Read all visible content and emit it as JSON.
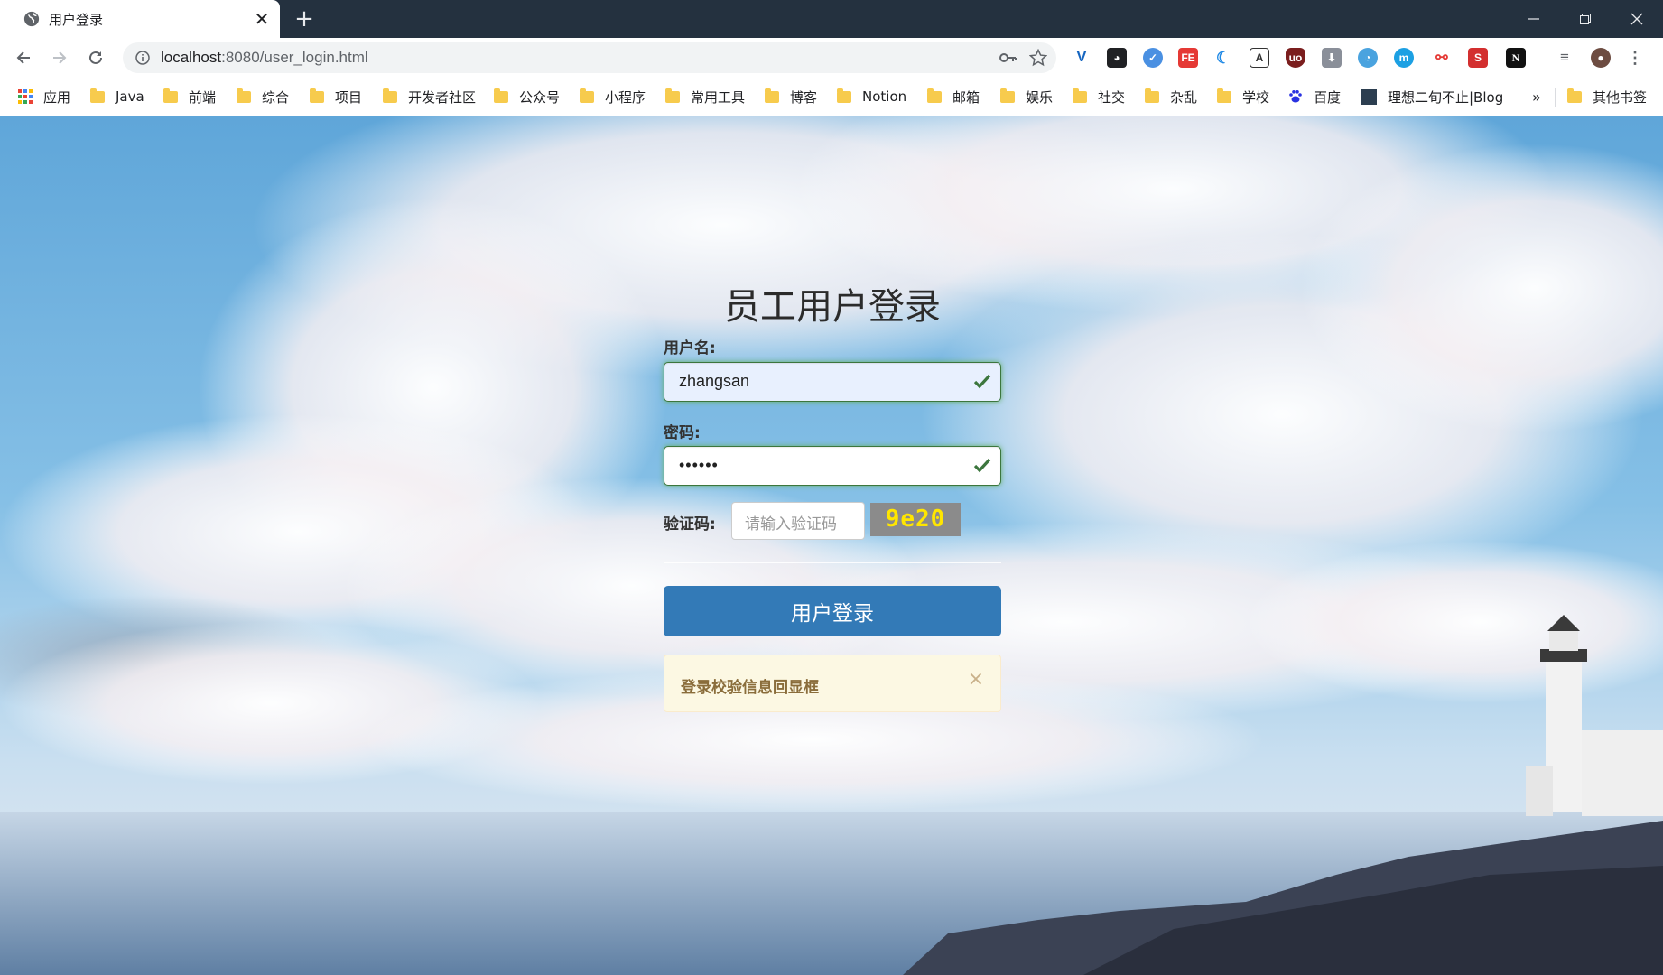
{
  "browser": {
    "tab_title": "用户登录",
    "new_tab_label": "+",
    "url_host": "localhost",
    "url_rest": ":8080/user_login.html"
  },
  "bookmarks": [
    {
      "label": "应用",
      "icon": "apps-grid-icon"
    },
    {
      "label": "Java",
      "icon": "folder-icon"
    },
    {
      "label": "前端",
      "icon": "folder-icon"
    },
    {
      "label": "综合",
      "icon": "folder-icon"
    },
    {
      "label": "项目",
      "icon": "folder-icon"
    },
    {
      "label": "开发者社区",
      "icon": "folder-icon"
    },
    {
      "label": "公众号",
      "icon": "folder-icon"
    },
    {
      "label": "小程序",
      "icon": "folder-icon"
    },
    {
      "label": "常用工具",
      "icon": "folder-icon"
    },
    {
      "label": "博客",
      "icon": "folder-icon"
    },
    {
      "label": "Notion",
      "icon": "folder-icon"
    },
    {
      "label": "邮箱",
      "icon": "folder-icon"
    },
    {
      "label": "娱乐",
      "icon": "folder-icon"
    },
    {
      "label": "社交",
      "icon": "folder-icon"
    },
    {
      "label": "杂乱",
      "icon": "folder-icon"
    },
    {
      "label": "学校",
      "icon": "folder-icon"
    },
    {
      "label": "百度",
      "icon": "baidu-paw-icon"
    },
    {
      "label": "理想二旬不止|Blog",
      "icon": "blog-favicon-icon"
    }
  ],
  "bookmarks_overflow": "»",
  "other_bookmarks": "其他书签",
  "login": {
    "title": "员工用户登录",
    "username_label": "用户名:",
    "username_value": "zhangsan",
    "password_label": "密码:",
    "password_value": "••••••",
    "captcha_label": "验证码:",
    "captcha_placeholder": "请输入验证码",
    "captcha_text": "9e20",
    "submit_label": "用户登录",
    "alert_message": "登录校验信息回显框",
    "alert_close": "×"
  },
  "colors": {
    "primary_button": "#337ab7",
    "success_border": "#3c763d",
    "alert_bg": "#fcf8e3",
    "alert_text": "#8a6d3b",
    "captcha_bg": "#8b8b8b",
    "captcha_text": "#ffe600"
  }
}
